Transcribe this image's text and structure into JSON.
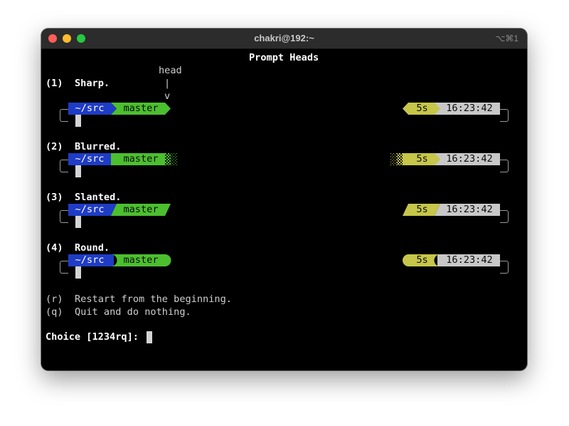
{
  "window": {
    "title": "chakri@192:~",
    "shortcut": "⌥⌘1"
  },
  "header": {
    "title": "Prompt Heads",
    "head_label": "head",
    "pipe": "|",
    "arrow": "v"
  },
  "options": [
    {
      "key": "(1)",
      "label": "Sharp."
    },
    {
      "key": "(2)",
      "label": "Blurred."
    },
    {
      "key": "(3)",
      "label": "Slanted."
    },
    {
      "key": "(4)",
      "label": "Round."
    }
  ],
  "prompt": {
    "dir": "~/src",
    "branch": "master",
    "duration": "5s",
    "time": "16:23:42"
  },
  "extra": [
    {
      "key": "(r)",
      "label": "Restart from the beginning."
    },
    {
      "key": "(q)",
      "label": "Quit and do nothing."
    }
  ],
  "choice_prompt": "Choice [1234rq]:",
  "colors": {
    "dir_bg": "#1f3cc6",
    "branch_bg": "#4cbf2f",
    "duration_bg": "#c6c64a",
    "time_bg": "#c8c8c8",
    "background": "#000000"
  }
}
